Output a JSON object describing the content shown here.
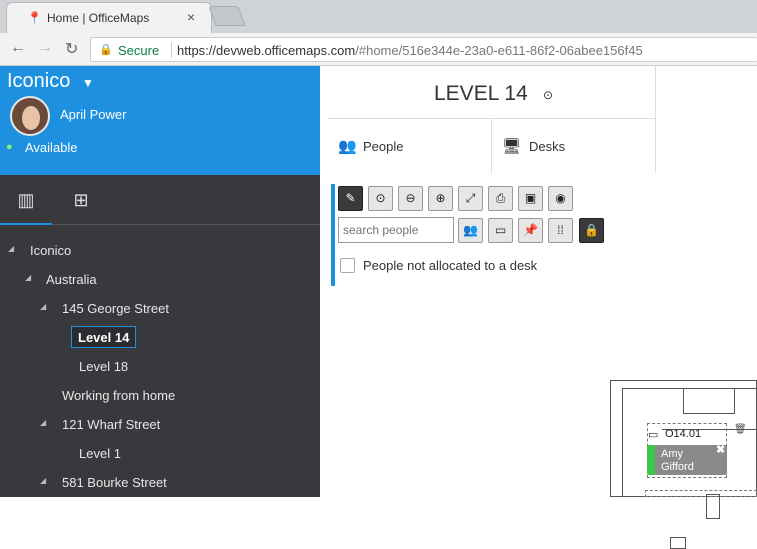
{
  "browser": {
    "tab_title": "Home | OfficeMaps",
    "tab_close": "×",
    "security_label": "Secure",
    "url_base": "https://devweb.officemaps.com",
    "url_rest": "/#home/516e344e-23a0-e611-86f2-06abee156f45"
  },
  "sidebar": {
    "org_name": "Iconico",
    "user_name": "April Power",
    "status": "Available",
    "tree": [
      {
        "label": "Iconico",
        "level": 0,
        "expanded": true
      },
      {
        "label": "Australia",
        "level": 1,
        "expanded": true
      },
      {
        "label": "145 George Street",
        "level": 2,
        "expanded": true
      },
      {
        "label": "Level 14",
        "level": 3,
        "selected": true
      },
      {
        "label": "Level 18",
        "level": 3
      },
      {
        "label": "Working from home",
        "level": 2
      },
      {
        "label": "121 Wharf Street",
        "level": 2,
        "expanded": true
      },
      {
        "label": "Level 1",
        "level": 3
      },
      {
        "label": "581 Bourke Street",
        "level": 2,
        "expanded": true
      }
    ]
  },
  "main": {
    "level_title": "LEVEL 14",
    "tabs": [
      {
        "label": "People",
        "icon": "people-icon"
      },
      {
        "label": "Desks",
        "icon": "monitor-icon"
      }
    ],
    "search_placeholder": "search people",
    "unallocated_label": "People not allocated to a desk",
    "desk": {
      "id": "O14.01",
      "person_first": "Amy",
      "person_last": "Gifford"
    }
  },
  "colors": {
    "accent": "#1d90e0",
    "sidebar_bg": "#38393d",
    "person_status": "#3cc84a"
  }
}
